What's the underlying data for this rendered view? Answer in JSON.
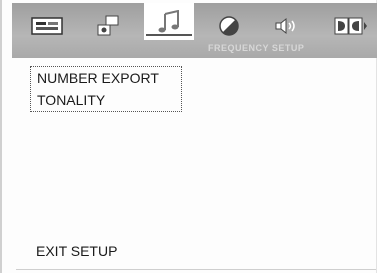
{
  "tabs": [
    {
      "id": "general",
      "icon": "monitor-icon",
      "active": false
    },
    {
      "id": "audio",
      "icon": "speaker-icon",
      "active": false
    },
    {
      "id": "music",
      "icon": "music-note-icon",
      "active": true
    },
    {
      "id": "video",
      "icon": "contrast-icon",
      "active": false
    },
    {
      "id": "speaker",
      "icon": "volume-icon",
      "active": false
    },
    {
      "id": "dolby",
      "icon": "dolby-icon",
      "active": false
    }
  ],
  "section_title": "FREQUENCY SETUP",
  "menu": {
    "items": [
      {
        "label": "NUMBER EXPORT"
      },
      {
        "label": "TONALITY"
      }
    ]
  },
  "exit_label": "EXIT SETUP",
  "colors": {
    "tabbar": "#a9a9a9",
    "active_tab": "#ffffff",
    "text": "#1a1a1a"
  }
}
